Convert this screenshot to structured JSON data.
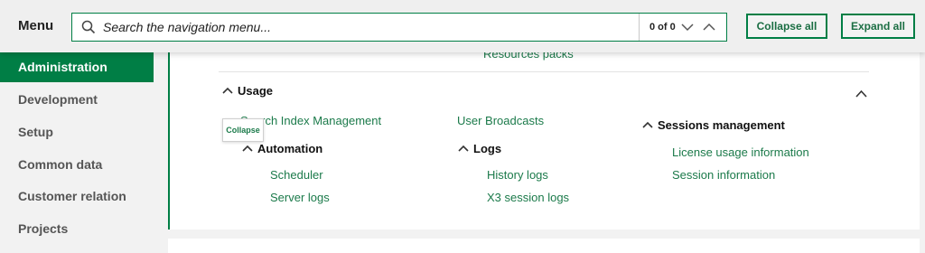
{
  "header": {
    "menu_label": "Menu",
    "search_placeholder": "Search the navigation menu...",
    "match_count": "0 of 0",
    "collapse_all_label": "Collapse all",
    "expand_all_label": "Expand all"
  },
  "sidebar": {
    "items": [
      {
        "label": "Administration",
        "active": true
      },
      {
        "label": "Development"
      },
      {
        "label": "Setup"
      },
      {
        "label": "Common data"
      },
      {
        "label": "Customer relation"
      },
      {
        "label": "Projects"
      }
    ]
  },
  "content": {
    "partial_link": "Resources packs",
    "usage_heading": "Usage",
    "search_index_link": "Search Index Management",
    "tooltip_label": "Collapse",
    "automation_heading": "Automation",
    "scheduler_link": "Scheduler",
    "server_logs_link": "Server logs",
    "user_broadcasts_link": "User Broadcasts",
    "logs_heading": "Logs",
    "history_logs_link": "History logs",
    "x3_session_logs_link": "X3 session logs",
    "sessions_heading": "Sessions management",
    "license_usage_link": "License usage information",
    "session_info_link": "Session information"
  },
  "colors": {
    "accent": "#007e45",
    "link": "#1b7a4a"
  }
}
